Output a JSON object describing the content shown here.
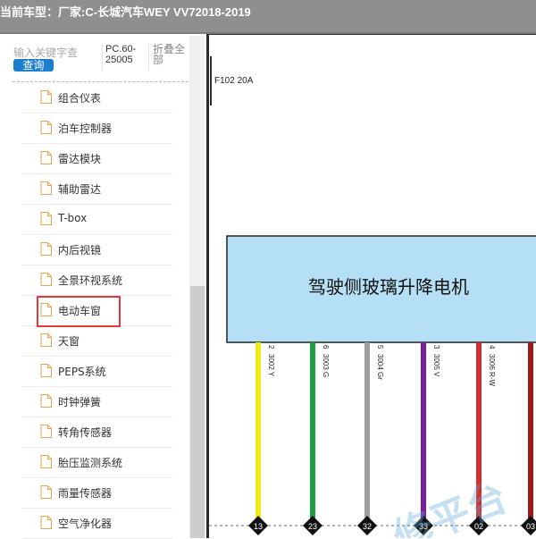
{
  "title_bar": {
    "text": "当前车型：厂家:C-长城汽车WEY VV72018-2019"
  },
  "search": {
    "placeholder": "输入关键字查",
    "button_label": "查询"
  },
  "code_label": "PC.60-25005",
  "collapse_label": "折叠全部",
  "tree": {
    "items": [
      {
        "label": "组合仪表"
      },
      {
        "label": "泊车控制器"
      },
      {
        "label": "雷达模块"
      },
      {
        "label": "辅助雷达"
      },
      {
        "label": "T-box"
      },
      {
        "label": "内后视镜"
      },
      {
        "label": "全景环视系统"
      },
      {
        "label": "电动车窗"
      },
      {
        "label": "天窗"
      },
      {
        "label": "PEPS系统"
      },
      {
        "label": "时钟弹簧"
      },
      {
        "label": "转角传感器"
      },
      {
        "label": "胎压监测系统"
      },
      {
        "label": "雨量传感器"
      },
      {
        "label": "空气净化器"
      }
    ],
    "selected": "电动车窗"
  },
  "diagram": {
    "fuse_label": "F102 20A",
    "component_label": "驾驶侧玻璃升降电机",
    "component_fill": "#b5dff5",
    "wires": [
      {
        "pin": "2",
        "code": "3002 Y",
        "color": "#f2ea16",
        "connector": "13"
      },
      {
        "pin": "6",
        "code": "3003 G",
        "color": "#1e9e3e",
        "connector": "23"
      },
      {
        "pin": "5",
        "code": "3004 Gr",
        "color": "#9e9e9e",
        "connector": "32"
      },
      {
        "pin": "3",
        "code": "3005 V",
        "color": "#7b1fa2",
        "connector": "33"
      },
      {
        "pin": "4",
        "code": "3006 R-W",
        "color": "#d32f2f",
        "connector": "02"
      },
      {
        "pin": "",
        "code": "",
        "color": "#a01818",
        "connector": "03"
      }
    ],
    "watermark": "修平台"
  }
}
